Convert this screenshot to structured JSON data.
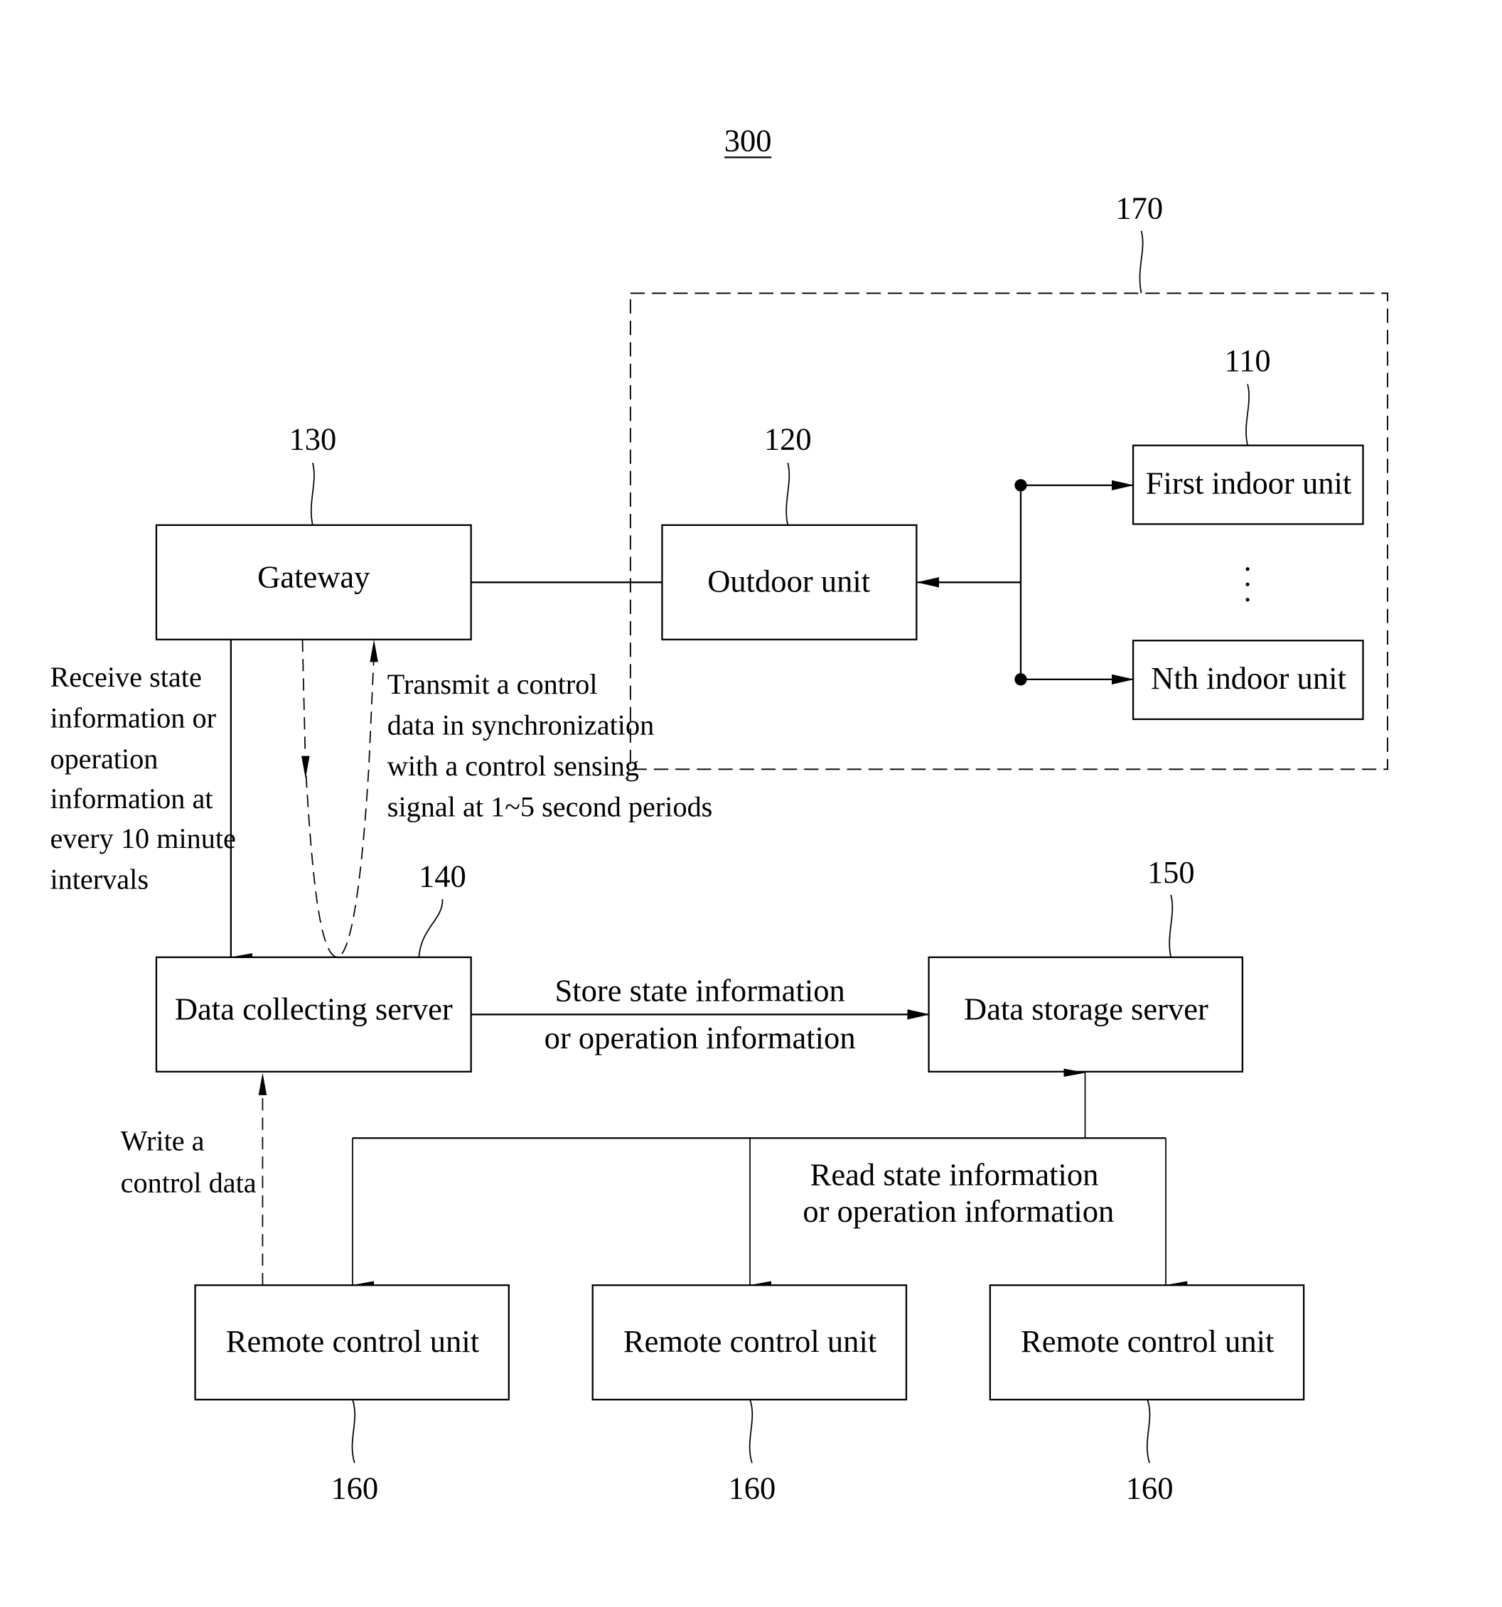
{
  "figure": {
    "system_ref": "300",
    "group_ref": "170",
    "colors": {
      "ink": "#000000",
      "background": "#ffffff"
    }
  },
  "nodes": {
    "first_indoor": {
      "label": "First indoor unit",
      "ref": "110"
    },
    "nth_indoor": {
      "label": "Nth indoor unit"
    },
    "ellipsis": "⋮",
    "outdoor": {
      "label": "Outdoor unit",
      "ref": "120"
    },
    "gateway": {
      "label": "Gateway",
      "ref": "130"
    },
    "collecting_server": {
      "label": "Data collecting server",
      "ref": "140"
    },
    "storage_server": {
      "label": "Data storage server",
      "ref": "150"
    },
    "remotes": [
      {
        "label": "Remote control unit",
        "ref": "160"
      },
      {
        "label": "Remote control unit",
        "ref": "160"
      },
      {
        "label": "Remote control unit",
        "ref": "160"
      }
    ]
  },
  "edges": {
    "receive_note": [
      "Receive state",
      "information or",
      "operation",
      "information at",
      "every 10 minute",
      "intervals"
    ],
    "transmit_note": [
      "Transmit a control",
      "data in synchronization",
      "with a control sensing",
      "signal at 1~5 second periods"
    ],
    "store_note": [
      "Store state information",
      "or operation information"
    ],
    "write_note": [
      "Write a",
      "control data"
    ],
    "read_note": [
      "Read state information",
      "or operation information"
    ]
  }
}
